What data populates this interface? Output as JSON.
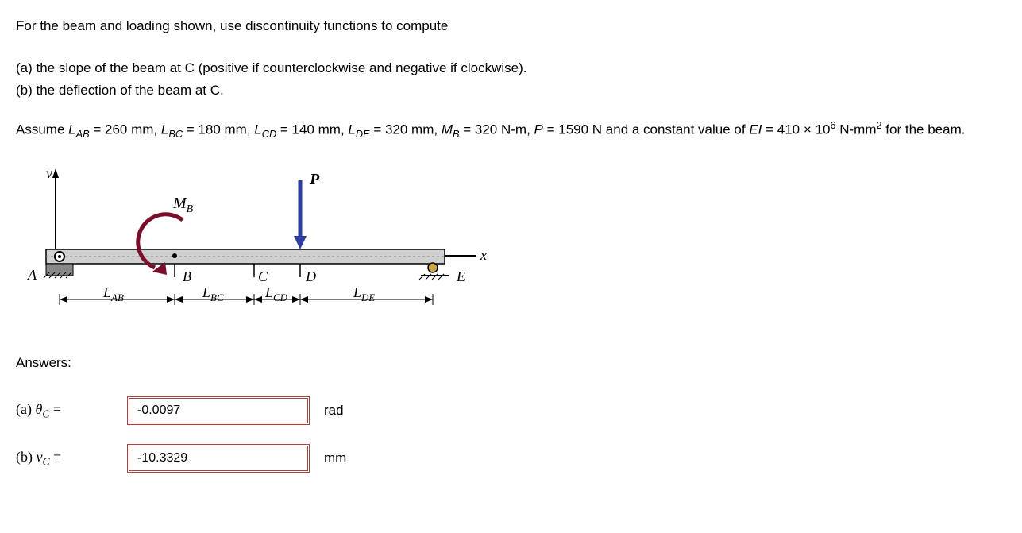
{
  "problem": {
    "intro": "For the beam and loading shown, use discontinuity functions to compute",
    "part_a": "(a) the slope of the beam at C (positive if counterclockwise and negative if clockwise).",
    "part_b": "(b) the deflection of the beam at C."
  },
  "assume": {
    "prefix": "Assume ",
    "LAB_label": "L",
    "LAB_sub": "AB",
    "LAB_val": " = 260 mm, ",
    "LBC_label": "L",
    "LBC_sub": "BC",
    "LBC_val": " = 180 mm, ",
    "LCD_label": "L",
    "LCD_sub": "CD",
    "LCD_val": " = 140 mm, ",
    "LDE_label": "L",
    "LDE_sub": "DE",
    "LDE_val": " = 320 mm, ",
    "MB_label": "M",
    "MB_sub": "B",
    "MB_val": " = 320 N-m, ",
    "P_label": "P",
    "P_val": " = 1590 N and a constant value of ",
    "EI_label": "EI",
    "EI_val": " = 410 × 10",
    "EI_sup": "6",
    "EI_unit": " N-mm",
    "EI_unit_sup": "2",
    "suffix": " for the beam."
  },
  "diagram": {
    "v": "v",
    "MB": "M",
    "MB_sub": "B",
    "P": "P",
    "A": "A",
    "B": "B",
    "C": "C",
    "D": "D",
    "E": "E",
    "x": "x",
    "LAB": "L",
    "LAB_sub": "AB",
    "LBC": "L",
    "LBC_sub": "BC",
    "LCD": "L",
    "LCD_sub": "CD",
    "LDE": "L",
    "LDE_sub": "DE"
  },
  "answers": {
    "heading": "Answers:",
    "a": {
      "label_prefix": "(a)   ",
      "theta": "θ",
      "sub": "C",
      "eq": " =",
      "value": "-0.0097",
      "unit": "rad"
    },
    "b": {
      "label_prefix": "(b)   ",
      "v": "v",
      "sub": "C",
      "eq": " =",
      "value": "-10.3329",
      "unit": "mm"
    }
  }
}
